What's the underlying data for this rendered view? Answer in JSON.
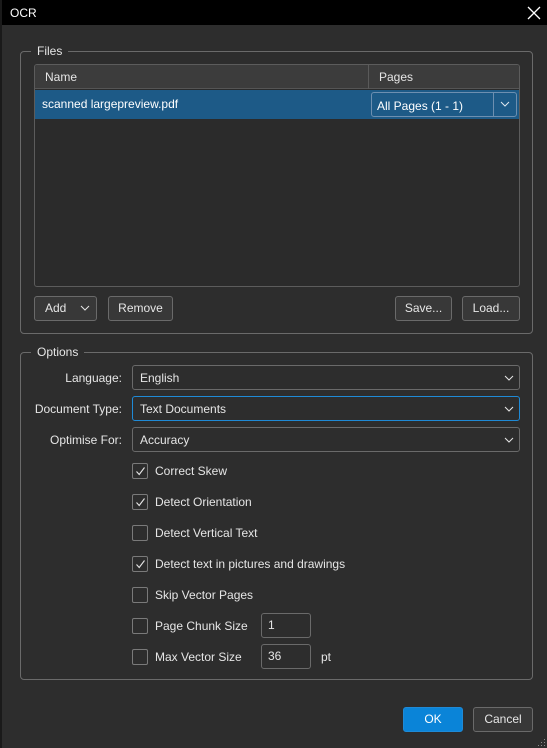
{
  "window": {
    "title": "OCR"
  },
  "files": {
    "legend": "Files",
    "columns": {
      "name": "Name",
      "pages": "Pages"
    },
    "rows": [
      {
        "name": "scanned largepreview.pdf",
        "pages": "All Pages (1 - 1)"
      }
    ],
    "buttons": {
      "add": "Add",
      "remove": "Remove",
      "save": "Save...",
      "load": "Load..."
    }
  },
  "options": {
    "legend": "Options",
    "language": {
      "label": "Language:",
      "value": "English"
    },
    "document_type": {
      "label": "Document Type:",
      "value": "Text Documents"
    },
    "optimise_for": {
      "label": "Optimise For:",
      "value": "Accuracy"
    },
    "checks": [
      {
        "label": "Correct Skew",
        "checked": true
      },
      {
        "label": "Detect Orientation",
        "checked": true
      },
      {
        "label": "Detect Vertical Text",
        "checked": false
      },
      {
        "label": "Detect text in pictures and drawings",
        "checked": true
      },
      {
        "label": "Skip Vector Pages",
        "checked": false
      },
      {
        "label": "Page Chunk Size",
        "checked": false,
        "value": "1"
      },
      {
        "label": "Max Vector Size",
        "checked": false,
        "value": "36",
        "unit": "pt"
      }
    ]
  },
  "footer": {
    "ok": "OK",
    "cancel": "Cancel"
  },
  "colors": {
    "accent": "#0a84d8",
    "selection": "#1d5a87",
    "background": "#2d2d2d",
    "titlebar": "#000000"
  }
}
